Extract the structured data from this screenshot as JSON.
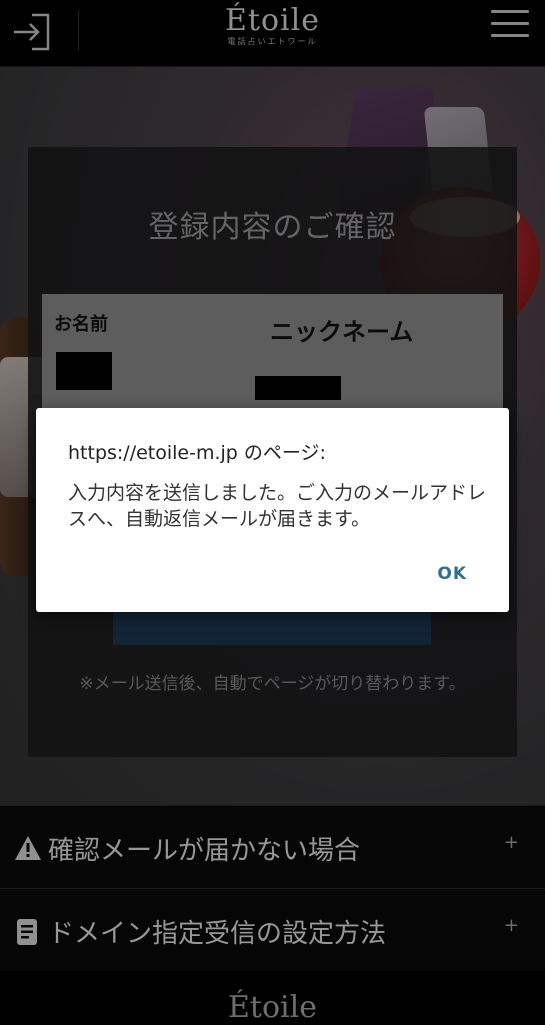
{
  "header": {
    "logo": "Étoile",
    "logo_sub": "電話占いエトワール",
    "login_icon": "login-icon",
    "menu_icon": "hamburger-menu-icon"
  },
  "panel": {
    "title": "登録内容のご確認",
    "name_label": "お名前",
    "nickname_label": "ニックネーム",
    "note": "※メール送信後、自動でページが切り替わります。"
  },
  "accordions": [
    {
      "label": "確認メールが届かない場合",
      "icon": "warning-icon",
      "toggle": "+"
    },
    {
      "label": "ドメイン指定受信の設定方法",
      "icon": "document-icon",
      "toggle": "+"
    }
  ],
  "footer": {
    "logo": "Étoile"
  },
  "dialog": {
    "title": "https://etoile-m.jp のページ:",
    "message": "入力内容を送信しました。ご入力のメールアドレスへ、自動返信メールが届きます。",
    "ok_label": "OK"
  },
  "colors": {
    "dialog_ok": "#2f6f8f",
    "submit_button": "#1c3a55"
  }
}
